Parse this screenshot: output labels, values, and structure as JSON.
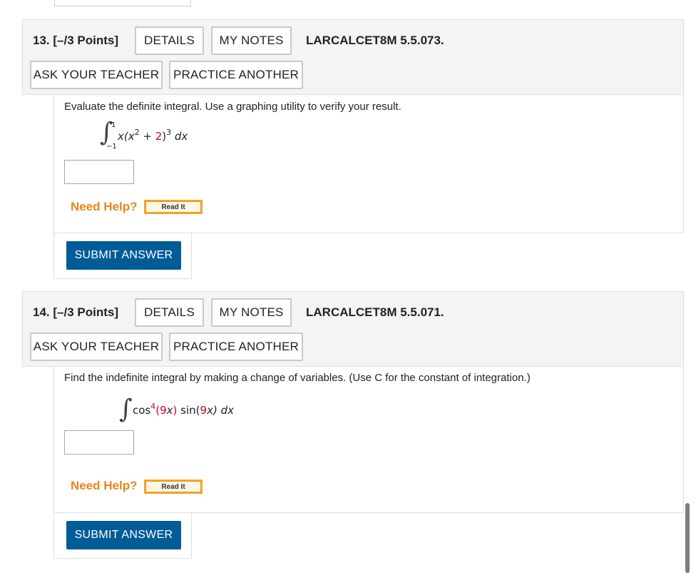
{
  "questions": [
    {
      "title": "13. [–/3 Points]",
      "details_label": "DETAILS",
      "my_notes_label": "MY NOTES",
      "code": "LARCALCET8M 5.5.073.",
      "ask_teacher_label": "ASK YOUR TEACHER",
      "practice_another_label": "PRACTICE ANOTHER",
      "prompt": "Evaluate the definite integral. Use a graphing utility to verify your result.",
      "integral": {
        "upper": "1",
        "lower": "−1",
        "expr_pre": "x(x",
        "exp1": "2",
        "expr_mid": " + ",
        "red_part": "2",
        "expr_post": ")",
        "exp2": "3",
        "dx": " dx"
      },
      "need_help": "Need Help?",
      "read_it": "Read It",
      "submit_label": "SUBMIT ANSWER"
    },
    {
      "title": "14. [–/3 Points]",
      "details_label": "DETAILS",
      "my_notes_label": "MY NOTES",
      "code": "LARCALCET8M 5.5.071.",
      "ask_teacher_label": "ASK YOUR TEACHER",
      "practice_another_label": "PRACTICE ANOTHER",
      "prompt": "Find the indefinite integral by making a change of variables. (Use C for the constant of integration.)",
      "integral": {
        "expr_pre": "cos",
        "exp1": "4",
        "red_part1": "(9",
        "expr_mid": "x",
        "red_part2": ")",
        "expr_sin": " sin(",
        "red_part3": "9",
        "expr_post": "x) dx"
      },
      "need_help": "Need Help?",
      "read_it": "Read It",
      "submit_label": "SUBMIT ANSWER"
    }
  ],
  "colors": {
    "submit_bg": "#005c97",
    "need_help": "#e8841a",
    "read_it_bg": "#f6a623",
    "accent_red": "#d0021b"
  }
}
